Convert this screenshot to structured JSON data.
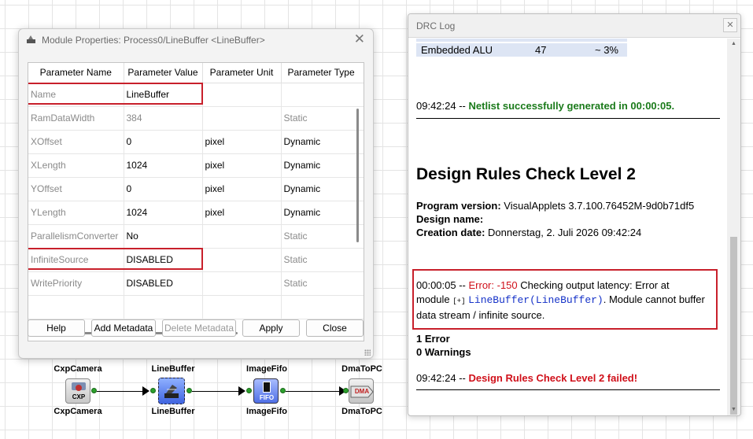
{
  "props_dialog": {
    "title": "Module Properties: Process0/LineBuffer <LineBuffer>",
    "close_glyph": "✕",
    "columns": [
      "Parameter Name",
      "Parameter Value",
      "Parameter Unit",
      "Parameter Type"
    ],
    "rows": [
      {
        "name": "Name",
        "value": "LineBuffer",
        "unit": "",
        "type": ""
      },
      {
        "name": "RamDataWidth",
        "value": "384",
        "unit": "",
        "type": "Static"
      },
      {
        "name": "XOffset",
        "value": "0",
        "unit": "pixel",
        "type": "Dynamic"
      },
      {
        "name": "XLength",
        "value": "1024",
        "unit": "pixel",
        "type": "Dynamic"
      },
      {
        "name": "YOffset",
        "value": "0",
        "unit": "pixel",
        "type": "Dynamic"
      },
      {
        "name": "YLength",
        "value": "1024",
        "unit": "pixel",
        "type": "Dynamic"
      },
      {
        "name": "ParallelismConverter",
        "value": "No",
        "unit": "",
        "type": "Static"
      },
      {
        "name": "InfiniteSource",
        "value": "DISABLED",
        "unit": "",
        "type": "Static"
      },
      {
        "name": "WritePriority",
        "value": "DISABLED",
        "unit": "",
        "type": "Static"
      }
    ],
    "buttons": {
      "help": "Help",
      "add_metadata": "Add Metadata",
      "delete_metadata": "Delete Metadata",
      "apply": "Apply",
      "close": "Close"
    }
  },
  "diagram": {
    "nodes": [
      {
        "label_top": "CxpCamera",
        "label_bottom": "CxpCamera",
        "icon_text": "CXP"
      },
      {
        "label_top": "LineBuffer",
        "label_bottom": "LineBuffer",
        "icon_text": ""
      },
      {
        "label_top": "ImageFifo",
        "label_bottom": "ImageFifo",
        "icon_text": "FIFO"
      },
      {
        "label_top": "DmaToPC",
        "label_bottom": "DmaToPC",
        "icon_text": "DMA"
      }
    ]
  },
  "drc_log": {
    "title": "DRC Log",
    "close_glyph": "✕",
    "alu_row": {
      "name": "Embedded ALU",
      "count": "47",
      "percent": "~ 3%"
    },
    "netlist_time": "09:42:24 --",
    "netlist_msg": "Netlist successfully generated in 00:00:05.",
    "heading": "Design Rules Check Level 2",
    "program_version_label": "Program version:",
    "program_version": "VisualApplets 3.7.100.76452M-9d0b71df5",
    "design_name_label": "Design name:",
    "creation_date_label": "Creation date:",
    "creation_date": "Donnerstag, 2. Juli 2026 09:42:24",
    "error_time": "00:00:05 --",
    "error_code": "Error: -150",
    "error_msg_1": "Checking output latency: Error at",
    "error_module_prefix": "module",
    "error_expand": "[+]",
    "error_module": "LineBuffer(LineBuffer)",
    "error_msg_2": ". Module cannot buffer",
    "error_msg_3": "data stream / infinite source.",
    "errors_count": "1 Error",
    "warnings_count": "0 Warnings",
    "fail_time": "09:42:24 --",
    "fail_msg": "Design Rules Check Level 2 failed!"
  }
}
